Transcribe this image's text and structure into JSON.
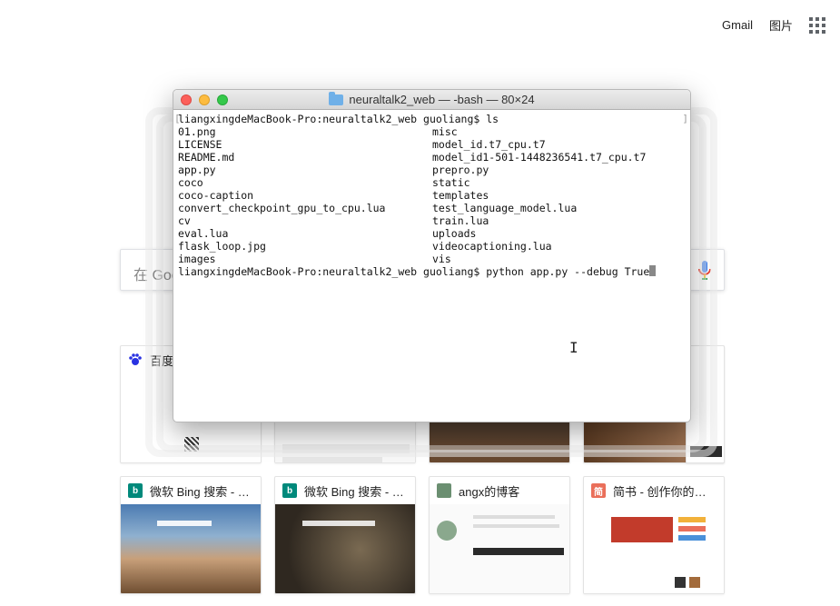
{
  "topbar": {
    "gmail": "Gmail",
    "images": "图片",
    "apps_icon": "apps-grid-icon"
  },
  "search": {
    "placeholder": "在 Google 上搜索，或者输入一个网址"
  },
  "tiles_top": [
    {
      "title": "百度一下，你就知道",
      "favicon_color": "#2932e1",
      "favicon_icon": "baidu-paw-icon"
    },
    {
      "title": "",
      "favicon_color": "#444444"
    },
    {
      "title": "",
      "favicon_color": "#444444"
    },
    {
      "title": "",
      "favicon_color": "#444444"
    },
    {
      "title": "",
      "favicon_color": "#444444"
    }
  ],
  "tiles_bottom": [
    {
      "title": "微软 Bing 搜索 - 国...",
      "favicon_color": "#00897b",
      "favicon_letter": "b"
    },
    {
      "title": "微软 Bing 搜索 - 国...",
      "favicon_color": "#00897b",
      "favicon_letter": "b"
    },
    {
      "title": "angx的博客",
      "favicon_color": "#6b8f71",
      "favicon_letter": ""
    },
    {
      "title": "简书 - 创作你的创作",
      "favicon_color": "#ea6f5a",
      "favicon_letter": "简"
    }
  ],
  "terminal": {
    "title": "neuraltalk2_web — -bash — 80×24",
    "prompt_line": "liangxingdeMacBook-Pro:neuraltalk2_web guoliang$ ls",
    "listing": [
      [
        "01.png",
        "misc"
      ],
      [
        "LICENSE",
        "model_id.t7_cpu.t7"
      ],
      [
        "README.md",
        "model_id1-501-1448236541.t7_cpu.t7"
      ],
      [
        "app.py",
        "prepro.py"
      ],
      [
        "coco",
        "static"
      ],
      [
        "coco-caption",
        "templates"
      ],
      [
        "convert_checkpoint_gpu_to_cpu.lua",
        "test_language_model.lua"
      ],
      [
        "cv",
        "train.lua"
      ],
      [
        "eval.lua",
        "uploads"
      ],
      [
        "flask_loop.jpg",
        "videocaptioning.lua"
      ],
      [
        "images",
        "vis"
      ]
    ],
    "command_line": "liangxingdeMacBook-Pro:neuraltalk2_web guoliang$ python app.py --debug True"
  }
}
